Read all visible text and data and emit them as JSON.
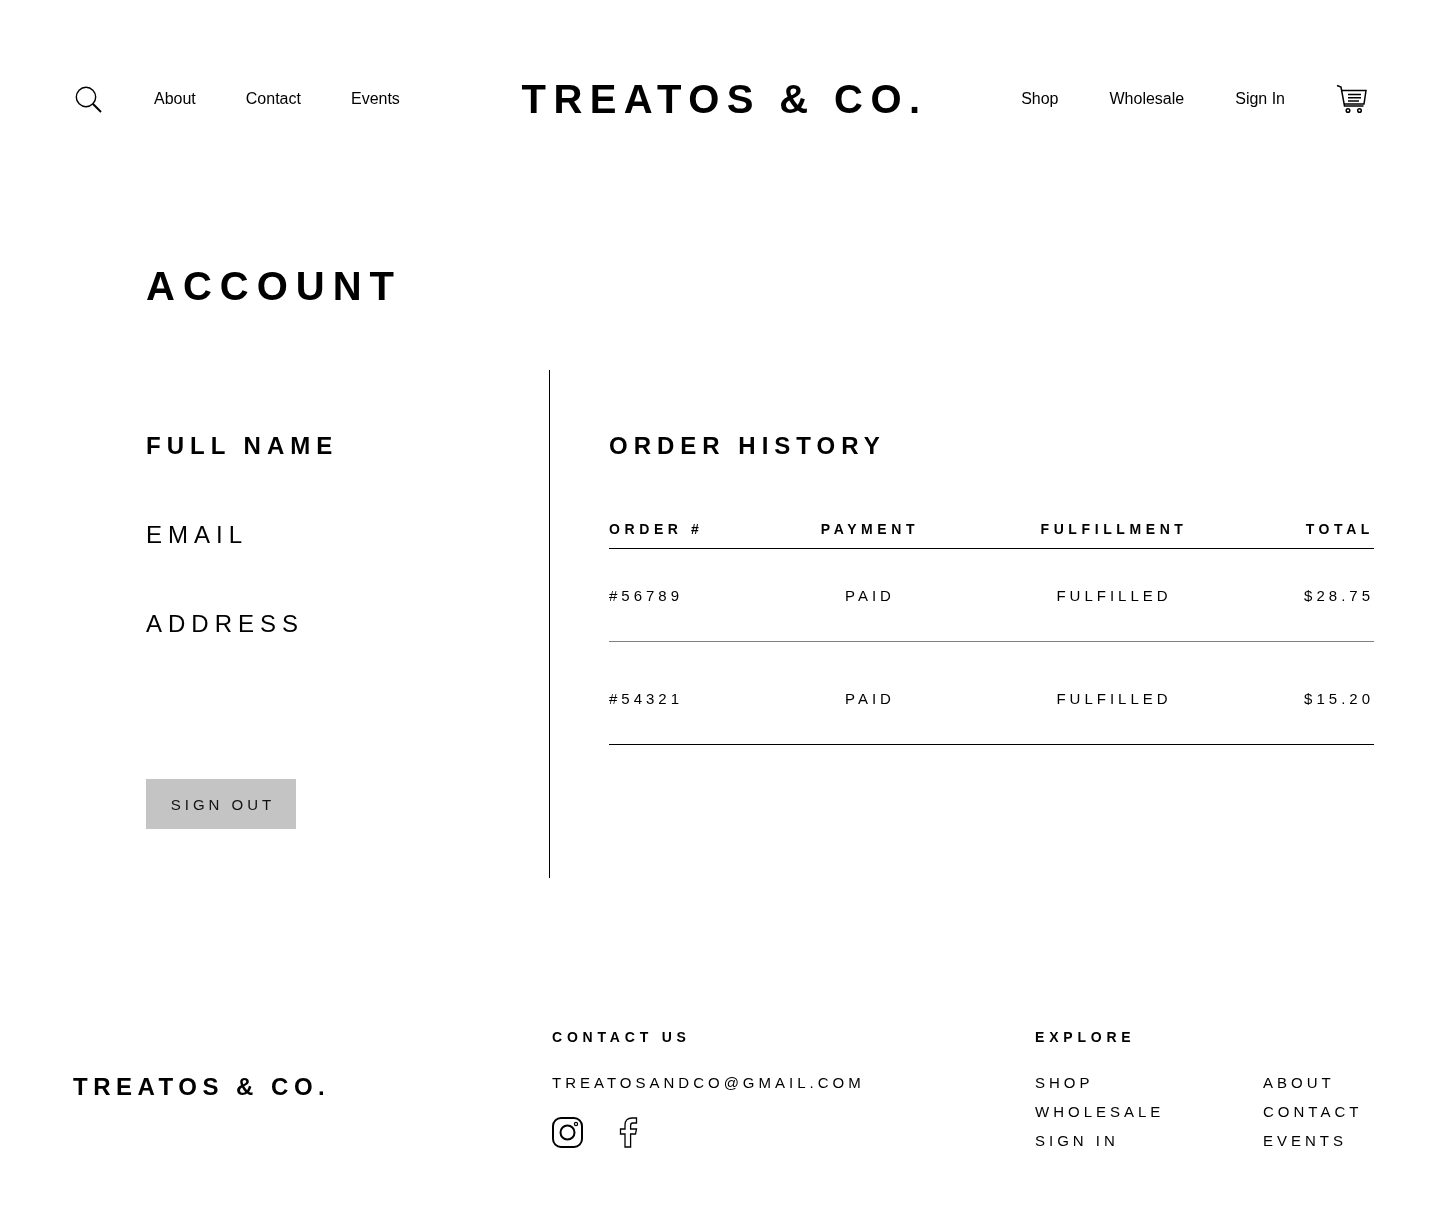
{
  "header": {
    "nav_left": [
      "About",
      "Contact",
      "Events"
    ],
    "logo": "TREATOS & CO.",
    "nav_right": [
      "Shop",
      "Wholesale",
      "Sign In"
    ]
  },
  "account": {
    "title": "ACCOUNT",
    "profile": {
      "name": "FULL NAME",
      "email": "EMAIL",
      "address": "ADDRESS"
    },
    "sign_out_button": "SIGN OUT"
  },
  "order_history": {
    "title": "ORDER HISTORY",
    "columns": [
      "ORDER #",
      "PAYMENT",
      "FULFILLMENT",
      "TOTAL"
    ],
    "rows": [
      [
        "#56789",
        "PAID",
        "FULFILLED",
        "$28.75"
      ],
      [
        "#54321",
        "PAID",
        "FULFILLED",
        "$15.20"
      ]
    ]
  },
  "footer": {
    "logo": "TREATOS & CO.",
    "contact": {
      "title": "CONTACT US",
      "email": "TREATOSANDCO@GMAIL.COM"
    },
    "explore": {
      "title": "EXPLORE",
      "link_columns": [
        [
          "SHOP",
          "WHOLESALE",
          "SIGN IN"
        ],
        [
          "ABOUT",
          "CONTACT",
          "EVENTS"
        ]
      ]
    }
  }
}
